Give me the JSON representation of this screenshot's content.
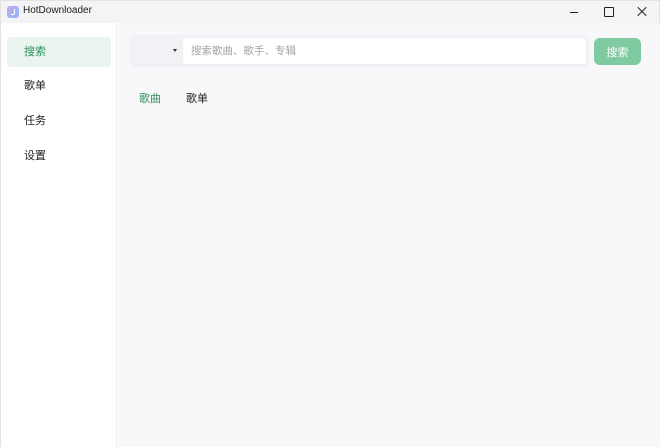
{
  "window": {
    "title": "HotDownloader"
  },
  "sidebar": {
    "items": [
      {
        "label": "搜索",
        "active": true
      },
      {
        "label": "歌单",
        "active": false
      },
      {
        "label": "任务",
        "active": false
      },
      {
        "label": "设置",
        "active": false
      }
    ]
  },
  "search": {
    "placeholder": "搜索歌曲、歌手、专辑",
    "value": "",
    "button_label": "搜索",
    "type_value": ""
  },
  "tabs": [
    {
      "label": "歌曲",
      "active": true
    },
    {
      "label": "歌单",
      "active": false
    }
  ],
  "colors": {
    "accent": "#2f8f5b",
    "accent_bg": "#e9f5ee",
    "button": "#7fcaa1"
  }
}
